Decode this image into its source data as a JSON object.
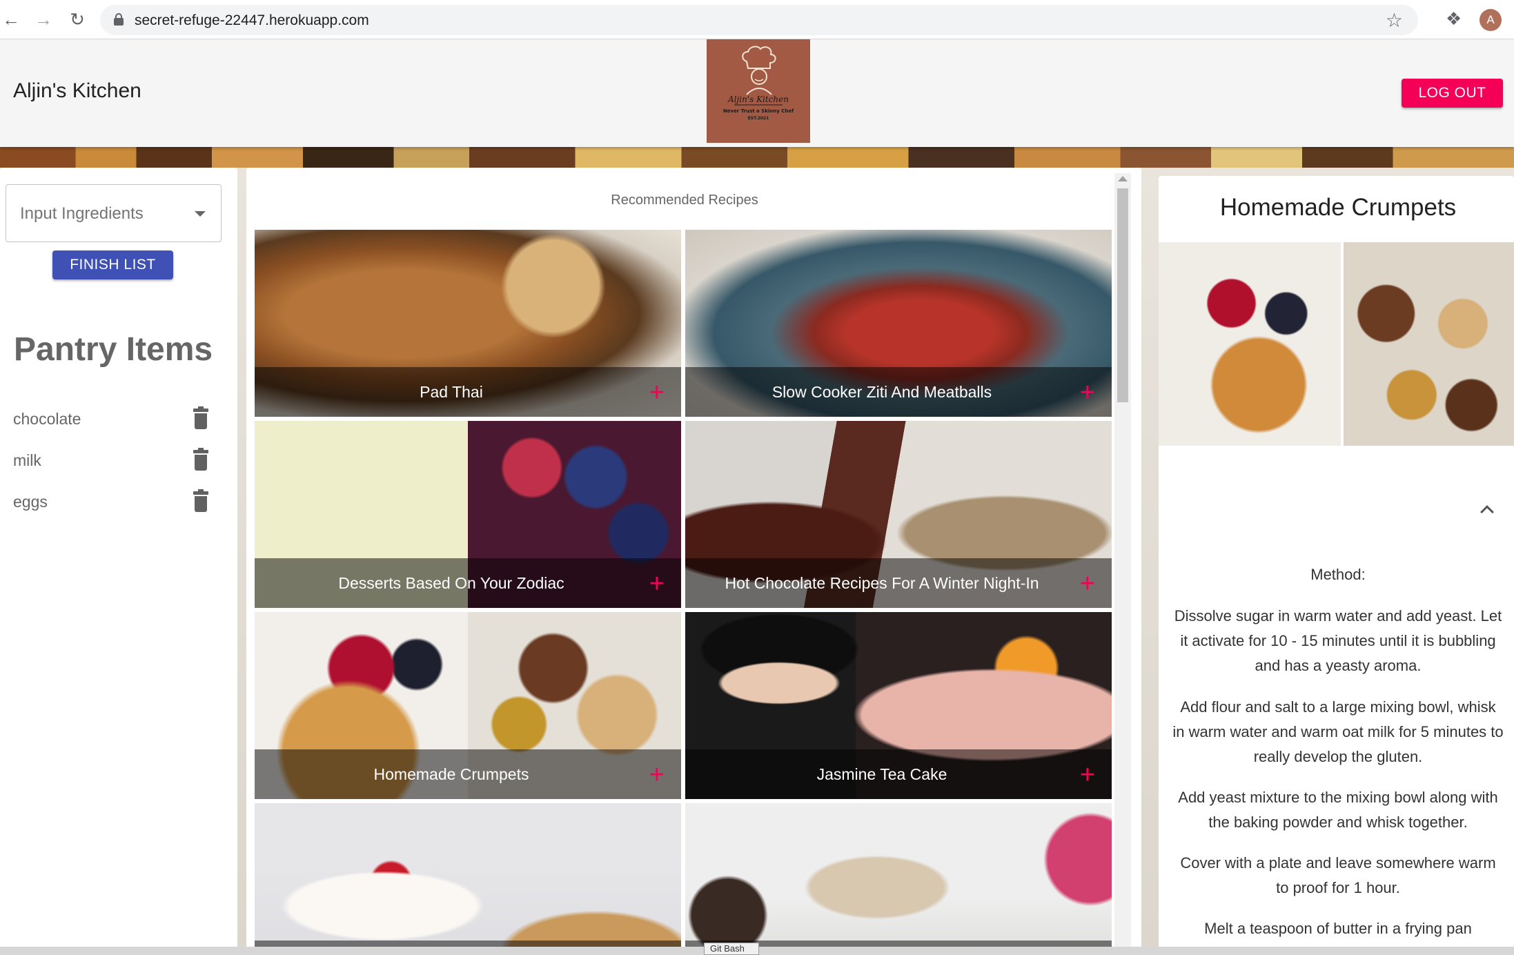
{
  "browser": {
    "url": "secret-refuge-22447.herokuapp.com",
    "avatar_letter": "A"
  },
  "header": {
    "brand": "Aljin's Kitchen",
    "logo": {
      "name": "Aljin's Kitchen",
      "tagline": "Never Trust a Skinny Chef",
      "est": "EST.2021",
      "bg_color": "#a35a45"
    },
    "logout_label": "LOG OUT"
  },
  "sidebar": {
    "input_placeholder": "Input Ingredients",
    "finish_label": "FINISH LIST",
    "pantry_title": "Pantry Items",
    "pantry_items": [
      {
        "label": "chocolate"
      },
      {
        "label": "milk"
      },
      {
        "label": "eggs"
      }
    ]
  },
  "recipes": {
    "section_title": "Recommended Recipes",
    "items": [
      {
        "title": "Pad Thai"
      },
      {
        "title": "Slow Cooker Ziti And Meatballs"
      },
      {
        "title": "Desserts Based On Your Zodiac"
      },
      {
        "title": "Hot Chocolate Recipes For A Winter Night-In"
      },
      {
        "title": "Homemade Crumpets"
      },
      {
        "title": "Jasmine Tea Cake"
      },
      {
        "title": ""
      },
      {
        "title": ""
      }
    ]
  },
  "detail": {
    "title": "Homemade Crumpets",
    "method_label": "Method:",
    "steps": [
      "Dissolve sugar in warm water and add yeast. Let it activate for 10 - 15 minutes until it is bubbling and has a yeasty aroma.",
      "Add flour and salt to a large mixing bowl, whisk in warm water and warm oat milk for 5 minutes to really develop the gluten.",
      "Add yeast mixture to the mixing bowl along with the baking powder and whisk together.",
      "Cover with a plate and leave somewhere warm to proof for 1 hour.",
      "Melt a teaspoon of butter in a frying pan"
    ]
  },
  "taskbar": {
    "item": "Git Bash"
  },
  "colors": {
    "accent_pink": "#f50057",
    "primary_blue": "#3f51b5"
  }
}
